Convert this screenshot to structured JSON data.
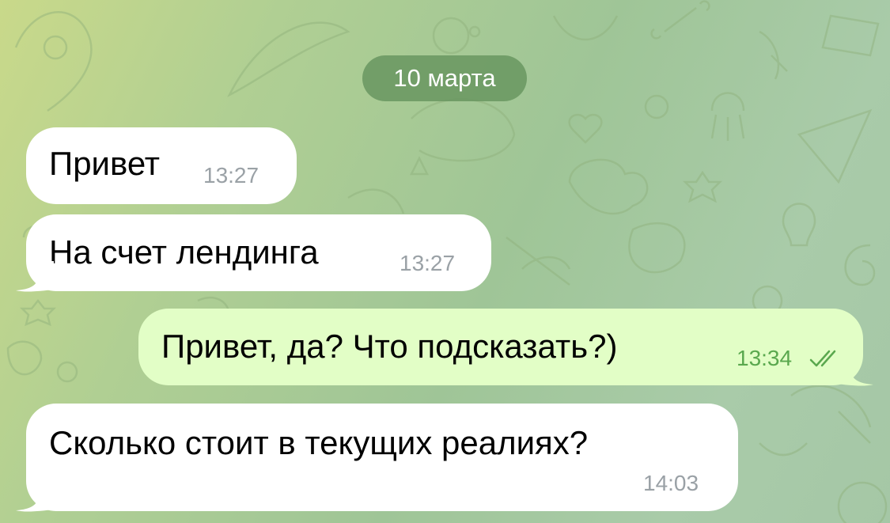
{
  "colors": {
    "incoming_bubble": "#ffffff",
    "outgoing_bubble": "#e2fec6",
    "date_pill": "#6a9862",
    "timestamp_in": "#9aa1a6",
    "timestamp_out": "#5aa84e"
  },
  "date_separator": "10 марта",
  "messages": [
    {
      "direction": "incoming",
      "text": "Привет",
      "time": "13:27"
    },
    {
      "direction": "incoming",
      "text": "На счет лендинга",
      "time": "13:27"
    },
    {
      "direction": "outgoing",
      "text": "Привет, да? Что подсказать?)",
      "time": "13:34",
      "status_icon": "double-check-icon"
    },
    {
      "direction": "incoming",
      "text": "Сколько стоит в текущих реалиях?",
      "time": "14:03"
    }
  ]
}
